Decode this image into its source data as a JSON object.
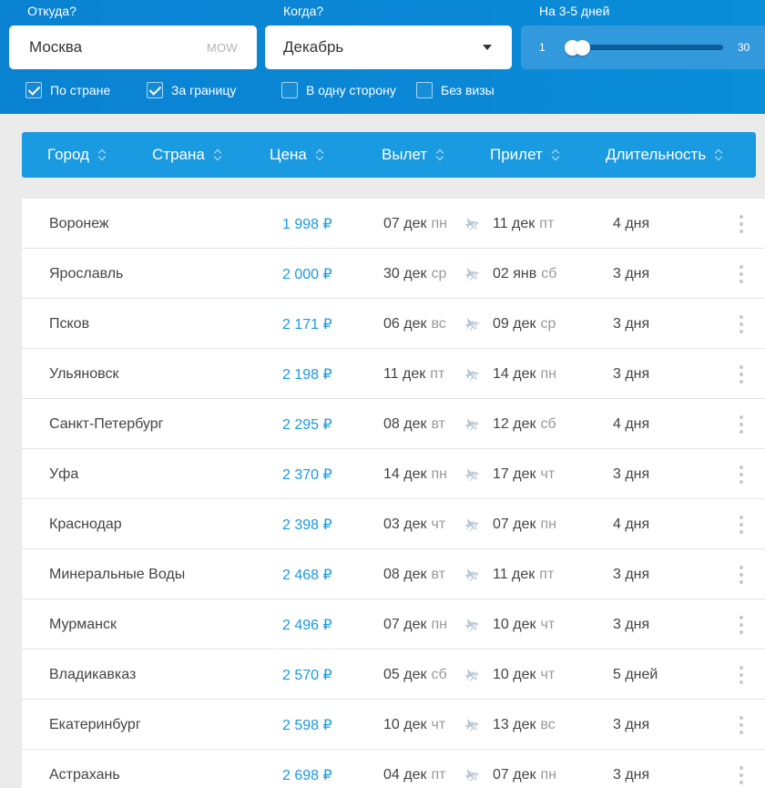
{
  "filters": {
    "from_label": "Откуда?",
    "from_value": "Москва",
    "from_code": "MOW",
    "when_label": "Когда?",
    "when_value": "Декабрь",
    "duration_label": "На 3-5 дней",
    "range_min": "1",
    "range_max": "30",
    "checkboxes": [
      {
        "label": "По стране",
        "checked": true
      },
      {
        "label": "За границу",
        "checked": true
      },
      {
        "label": "В одну сторону",
        "checked": false
      },
      {
        "label": "Без визы",
        "checked": false
      }
    ]
  },
  "table": {
    "columns": [
      "Город",
      "Страна",
      "Цена",
      "Вылет",
      "Прилет",
      "Длительность"
    ],
    "rows": [
      {
        "city": "Воронеж",
        "price": "1 998 ₽",
        "dep_date": "07 дек",
        "dep_day": "пн",
        "arr_date": "11 дек",
        "arr_day": "пт",
        "duration": "4 дня"
      },
      {
        "city": "Ярославль",
        "price": "2 000 ₽",
        "dep_date": "30 дек",
        "dep_day": "ср",
        "arr_date": "02 янв",
        "arr_day": "сб",
        "duration": "3 дня"
      },
      {
        "city": "Псков",
        "price": "2 171 ₽",
        "dep_date": "06 дек",
        "dep_day": "вс",
        "arr_date": "09 дек",
        "arr_day": "ср",
        "duration": "3 дня"
      },
      {
        "city": "Ульяновск",
        "price": "2 198 ₽",
        "dep_date": "11 дек",
        "dep_day": "пт",
        "arr_date": "14 дек",
        "arr_day": "пн",
        "duration": "3 дня"
      },
      {
        "city": "Санкт-Петербург",
        "price": "2 295 ₽",
        "dep_date": "08 дек",
        "dep_day": "вт",
        "arr_date": "12 дек",
        "arr_day": "сб",
        "duration": "4 дня"
      },
      {
        "city": "Уфа",
        "price": "2 370 ₽",
        "dep_date": "14 дек",
        "dep_day": "пн",
        "arr_date": "17 дек",
        "arr_day": "чт",
        "duration": "3 дня"
      },
      {
        "city": "Краснодар",
        "price": "2 398 ₽",
        "dep_date": "03 дек",
        "dep_day": "чт",
        "arr_date": "07 дек",
        "arr_day": "пн",
        "duration": "4 дня"
      },
      {
        "city": "Минеральные Воды",
        "price": "2 468 ₽",
        "dep_date": "08 дек",
        "dep_day": "вт",
        "arr_date": "11 дек",
        "arr_day": "пт",
        "duration": "3 дня"
      },
      {
        "city": "Мурманск",
        "price": "2 496 ₽",
        "dep_date": "07 дек",
        "dep_day": "пн",
        "arr_date": "10 дек",
        "arr_day": "чт",
        "duration": "3 дня"
      },
      {
        "city": "Владикавказ",
        "price": "2 570 ₽",
        "dep_date": "05 дек",
        "dep_day": "сб",
        "arr_date": "10 дек",
        "arr_day": "чт",
        "duration": "5 дней"
      },
      {
        "city": "Екатеринбург",
        "price": "2 598 ₽",
        "dep_date": "10 дек",
        "dep_day": "чт",
        "arr_date": "13 дек",
        "arr_day": "вс",
        "duration": "3 дня"
      },
      {
        "city": "Астрахань",
        "price": "2 698 ₽",
        "dep_date": "04 дек",
        "dep_day": "пт",
        "arr_date": "07 дек",
        "arr_day": "пн",
        "duration": "3 дня"
      }
    ]
  },
  "colors": {
    "topbar": "#0a86d4",
    "header": "#1a9ae0",
    "price": "#1a9ae0",
    "slider_field": "#3399dd"
  }
}
